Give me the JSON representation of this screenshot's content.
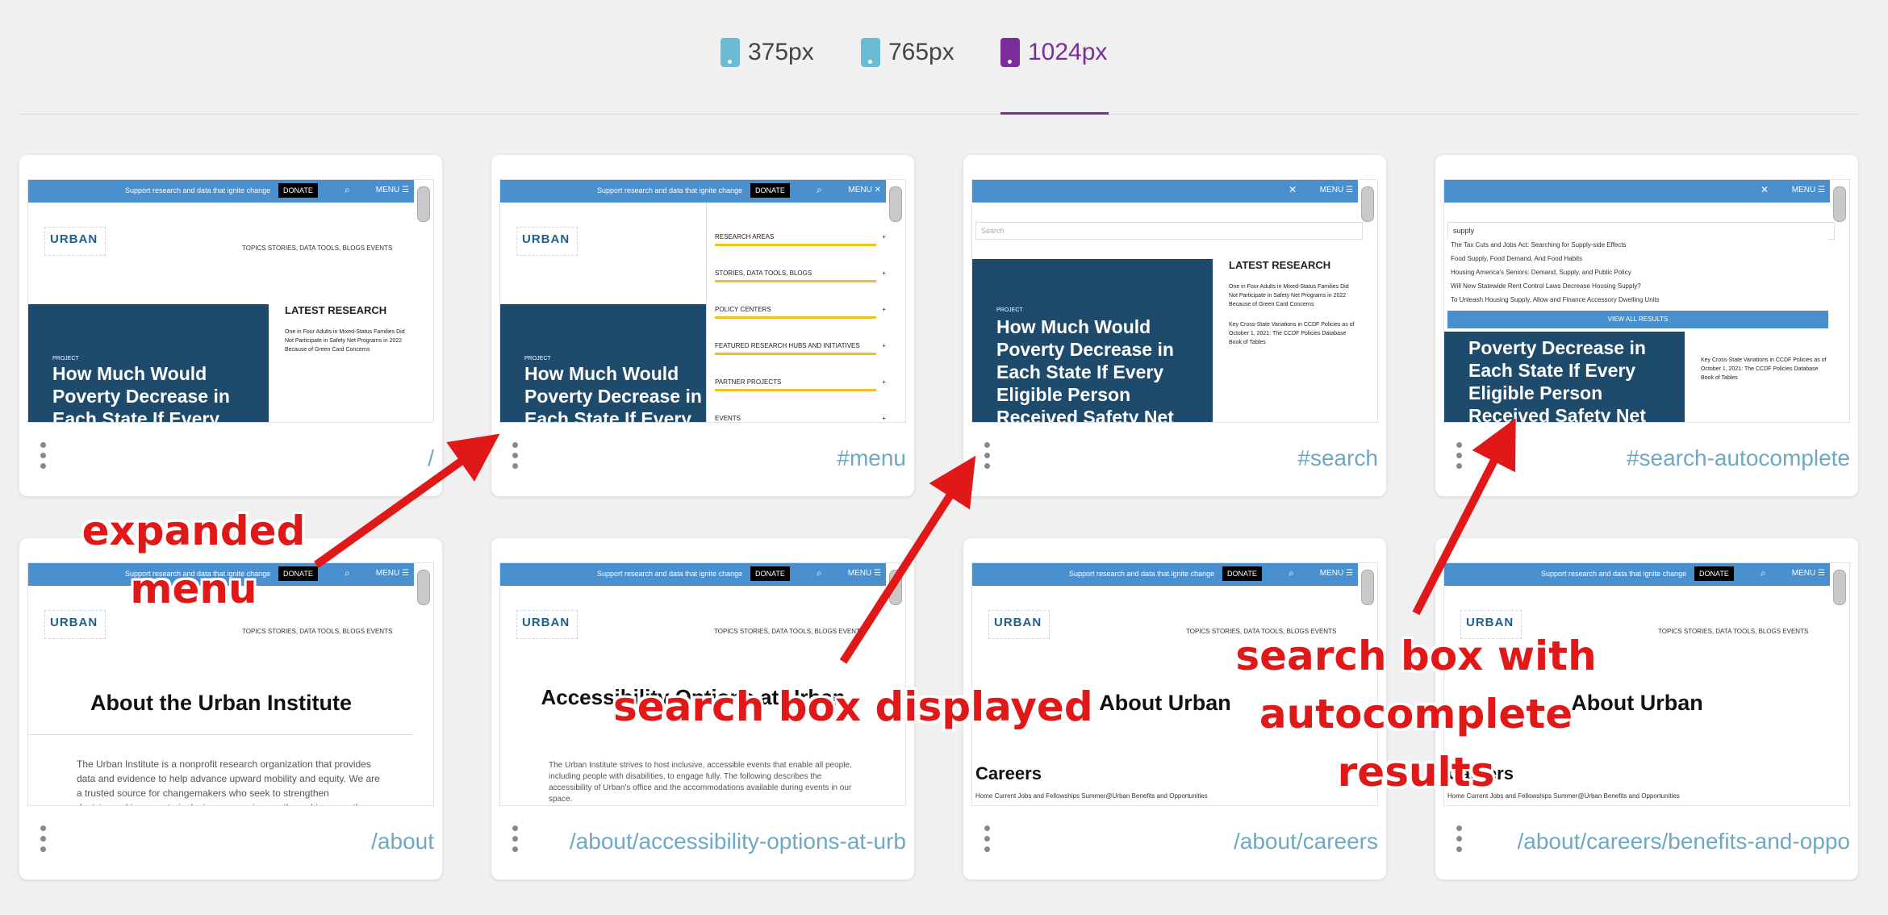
{
  "tabs": [
    {
      "label": "375px",
      "icon": "phone-icon"
    },
    {
      "label": "765px",
      "icon": "tablet-icon"
    },
    {
      "label": "1024px",
      "icon": "desktop-icon",
      "active": true
    }
  ],
  "colors": {
    "accent": "#7b2d9c",
    "link": "#6ea8c3",
    "annotation": "#e01818",
    "site_bar": "#4a8fce",
    "hero": "#1e4a6b"
  },
  "site": {
    "support": "Support research and data that ignite change",
    "donate": "DONATE",
    "menu": "MENU",
    "logo": "URBAN",
    "nav": "TOPICS    STORIES, DATA TOOLS, BLOGS    EVENTS",
    "latest": "LATEST RESEARCH",
    "latest_item_1": "One in Four Adults in Mixed-Status Families Did Not Participate in Safety Net Programs in 2022 Because of Green Card Concerns",
    "latest_item_2": "Key Cross-State Variations in CCDF Policies as of October 1, 2021: The CCDF Policies Database Book of Tables",
    "hero_kicker": "PROJECT",
    "hero_title": "How Much Would Poverty Decrease in Each State If Every",
    "hero_title_search": "How Much Would Poverty Decrease in Each State If Every Eligible Person Received Safety Net",
    "hero_title_ac": "Poverty Decrease in Each State If Every Eligible Person Received Safety Net",
    "search_placeholder": "Search",
    "search_query": "supply",
    "view_all": "VIEW ALL RESULTS"
  },
  "menu_items": [
    "RESEARCH AREAS",
    "STORIES, DATA TOOLS, BLOGS",
    "POLICY CENTERS",
    "FEATURED RESEARCH HUBS AND INITIATIVES",
    "PARTNER PROJECTS",
    "EVENTS"
  ],
  "autocomplete": [
    "The Tax Cuts and Jobs Act: Searching for Supply-side Effects",
    "Food Supply, Food Demand, And Food Habits",
    "Housing America's Seniors: Demand, Supply, and Public Policy",
    "Will New Statewide Rent Control Laws Decrease Housing Supply?",
    "To Unleash Housing Supply, Allow and Finance Accessory Dwelling Units"
  ],
  "pages": {
    "about_title": "About the Urban Institute",
    "about_body": "The Urban Institute is a nonprofit research organization that provides data and evidence to help advance upward mobility and equity. We are a trusted source for changemakers who seek to strengthen decisionmaking, create inclusive economic growth, and improve the",
    "access_title": "Accessibility Options at Urban",
    "access_body": "The Urban Institute strives to host inclusive, accessible events that enable all people, including people with disabilities, to engage fully. The following describes the accessibility of Urban's office and the accommodations available during events in our space.",
    "careers_about": "About Urban",
    "careers": "Careers",
    "careers_nav": "Home    Current Jobs and Fellowships    Summer@Urban    Benefits and Opportunities"
  },
  "cards": [
    {
      "path": "/"
    },
    {
      "path": "#menu"
    },
    {
      "path": "#search"
    },
    {
      "path": "#search-autocomplete"
    },
    {
      "path": "/about"
    },
    {
      "path": "/about/accessibility-options-at-urb"
    },
    {
      "path": "/about/careers"
    },
    {
      "path": "/about/careers/benefits-and-oppo"
    }
  ],
  "annotations": {
    "expanded_menu": "expanded\nmenu",
    "search_box": "search box displayed",
    "search_autocomplete": "search box with\nautocomplete\nresults"
  }
}
